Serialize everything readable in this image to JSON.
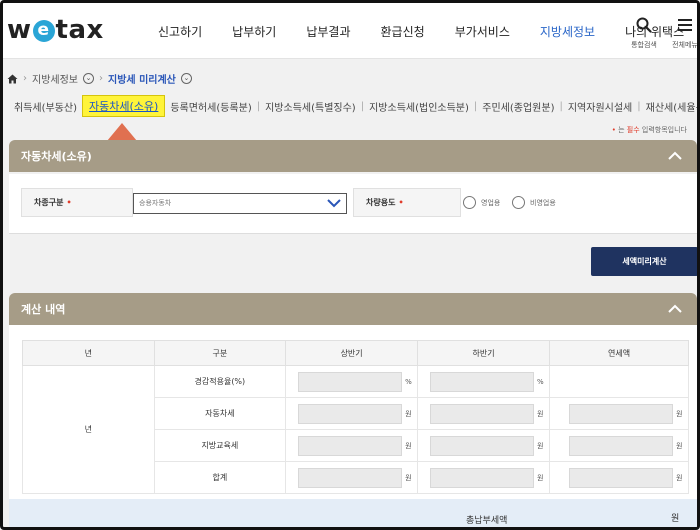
{
  "header": {
    "logo": {
      "left": "w",
      "mid": "e",
      "right": "tax"
    },
    "nav": [
      "신고하기",
      "납부하기",
      "납부결과",
      "환급신청",
      "부가서비스",
      "지방세정보",
      "나의 위택스"
    ],
    "active_nav": "지방세정보",
    "search_label": "통합검색",
    "menu_label": "전체메뉴"
  },
  "breadcrumb": {
    "items": [
      "지방세정보",
      "지방세 미리계산"
    ]
  },
  "subtabs": [
    "취득세(부동산)",
    "자동차세(소유)",
    "등록면허세(등록분)",
    "지방소득세(특별징수)",
    "지방소득세(법인소득분)",
    "주민세(종업원분)",
    "지역자원시설세",
    "재산세(세율특례)"
  ],
  "required_note": {
    "star": "•",
    "text_before": "는",
    "highlight": "필수",
    "text_after": "입력항목입니다"
  },
  "section1": {
    "title": "자동차세(소유)",
    "car_type_label": "차종구분",
    "car_type_value": "승용자동차",
    "usage_label": "차량용도",
    "usage_options": [
      "영업용",
      "비영업용"
    ],
    "required_star": "•"
  },
  "calc_button": "세액미리계산",
  "section2": {
    "title": "계산 내역",
    "columns": [
      "년",
      "구분",
      "상반기",
      "하반기",
      "연세액"
    ],
    "year_cell": "년",
    "rows": [
      {
        "label": "경감적용율(%)",
        "unit": "%"
      },
      {
        "label": "자동차세",
        "unit": "원"
      },
      {
        "label": "지방교육세",
        "unit": "원"
      },
      {
        "label": "합계",
        "unit": "원"
      }
    ]
  },
  "footer": {
    "total_label": "총납부세액",
    "unit": "원"
  },
  "colors": {
    "bar": "#a69c87",
    "button": "#1f3360",
    "accent_blue": "#2a66c8",
    "highlight": "#fff43a",
    "arrow": "#e07050"
  }
}
